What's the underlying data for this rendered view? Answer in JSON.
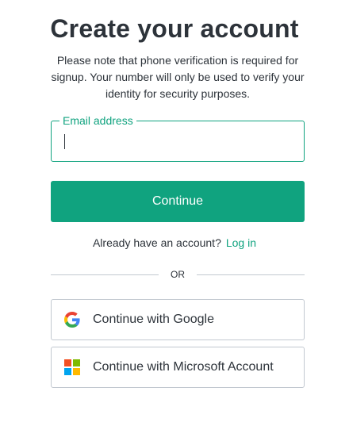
{
  "header": {
    "title": "Create your account",
    "subtitle": "Please note that phone verification is required for signup. Your number will only be used to verify your identity for security purposes."
  },
  "email": {
    "label": "Email address",
    "value": "",
    "placeholder": ""
  },
  "continue_label": "Continue",
  "login": {
    "prompt": "Already have an account?",
    "link_label": "Log in"
  },
  "divider_label": "OR",
  "social": {
    "google": {
      "label": "Continue with Google",
      "icon": "google-logo-icon"
    },
    "microsoft": {
      "label": "Continue with Microsoft Account",
      "icon": "microsoft-logo-icon"
    }
  },
  "colors": {
    "accent": "#10a37f",
    "text": "#2d333a",
    "border": "#c2c8d0"
  }
}
